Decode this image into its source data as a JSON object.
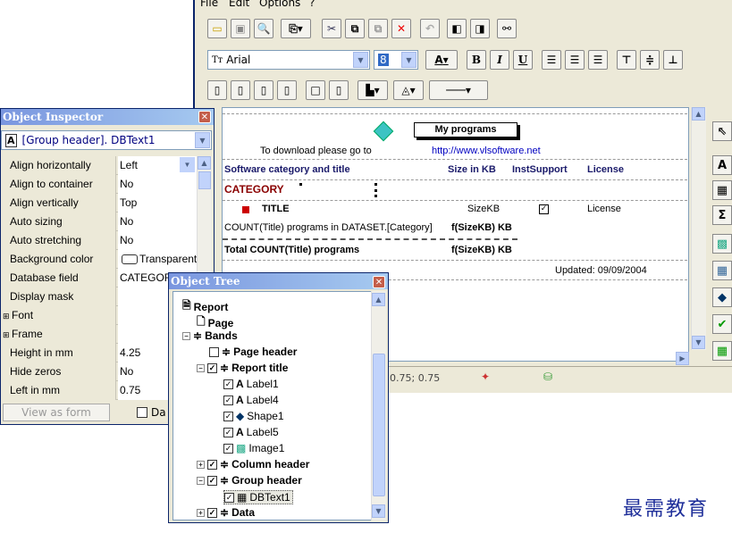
{
  "menu": [
    "File",
    "Edit",
    "Options",
    "?"
  ],
  "toolbar": {
    "font_name": "Arial",
    "font_size": "8",
    "bold": "B",
    "italic": "I",
    "underline": "U",
    "font_color": "A"
  },
  "design": {
    "title_box": "My programs",
    "download_text": "To download please go to",
    "url": "http://www.vlsoftware.net",
    "col_header_1": "Software category and title",
    "col_header_2": "Size in KB",
    "col_header_3": "InstSupport",
    "col_header_4": "License",
    "category": "CATEGORY",
    "title": "TITLE",
    "sizekb": "SizeKB",
    "license": "License",
    "count_dataset": "COUNT(Title) programs in DATASET.[Category]",
    "sum1": "f(SizeKB) KB",
    "total_count": "Total COUNT(Title) programs",
    "sum2": "f(SizeKB) KB",
    "updated": "Updated: 09/09/2004"
  },
  "status": {
    "coords": "0.75;  0.75"
  },
  "object_inspector": {
    "title": "Object Inspector",
    "selected": "[Group header].  DBText1",
    "properties": [
      {
        "name": "Align horizontally",
        "value": "Left"
      },
      {
        "name": "Align to container",
        "value": "No"
      },
      {
        "name": "Align vertically",
        "value": "Top"
      },
      {
        "name": "Auto sizing",
        "value": "No"
      },
      {
        "name": "Auto stretching",
        "value": "No"
      },
      {
        "name": "Background color",
        "value": "Transparent"
      },
      {
        "name": "Database field",
        "value": "CATEGORY"
      },
      {
        "name": "Display mask",
        "value": ""
      },
      {
        "name": "Font",
        "value": ""
      },
      {
        "name": "Frame",
        "value": ""
      },
      {
        "name": "Height in mm",
        "value": "4.25"
      },
      {
        "name": "Hide zeros",
        "value": "No"
      },
      {
        "name": "Left in mm",
        "value": "0.75"
      }
    ],
    "view_as_form": "View as form",
    "da_label": "Da"
  },
  "object_tree": {
    "title": "Object Tree",
    "items": [
      "Report",
      "Page",
      "Bands",
      "Page header",
      "Report title",
      "Label1",
      "Label4",
      "Shape1",
      "Label5",
      "Image1",
      "Column header",
      "Group header",
      "DBText1",
      "Data"
    ]
  },
  "brand": "最需教育"
}
